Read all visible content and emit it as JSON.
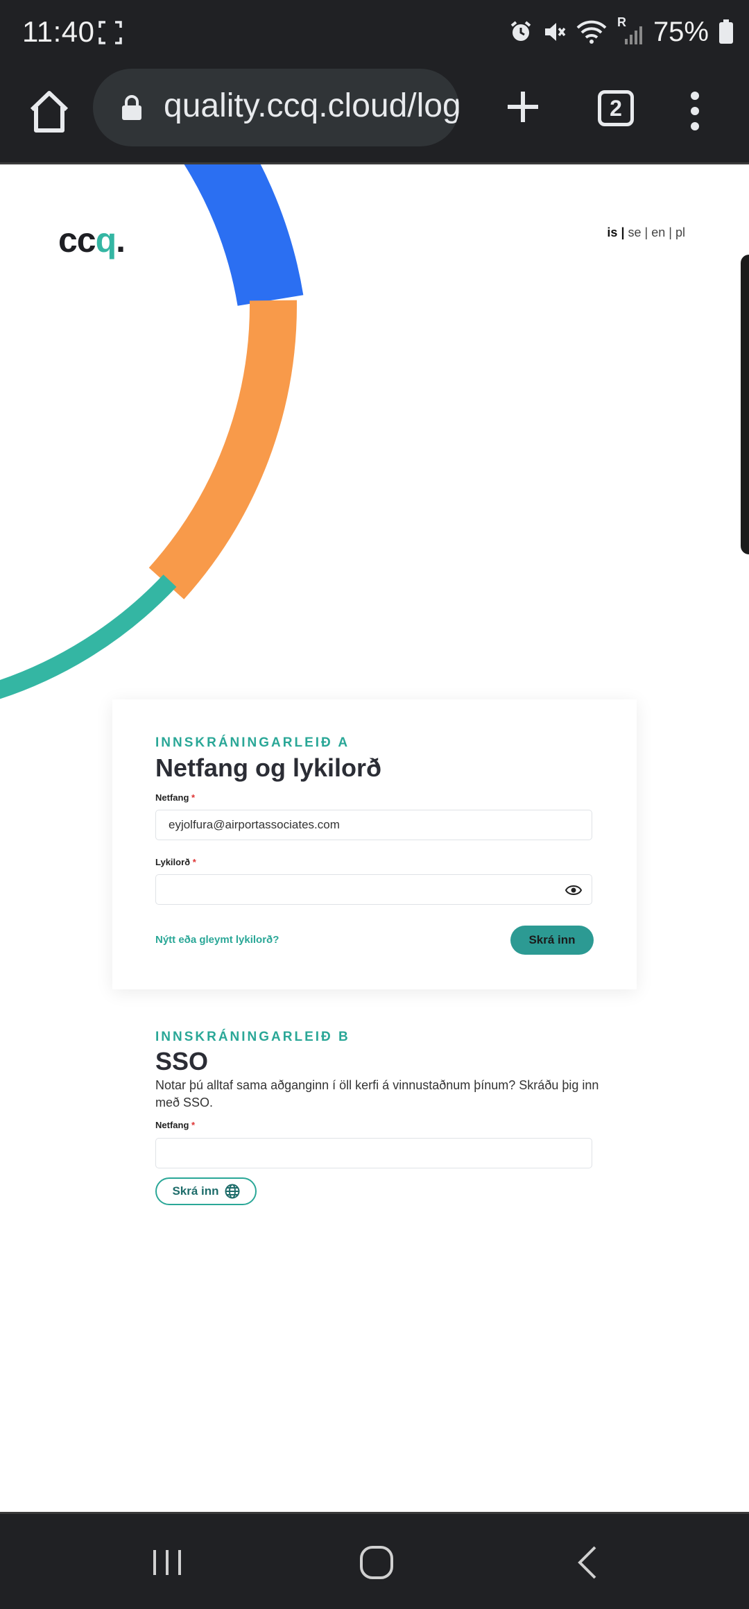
{
  "status_bar": {
    "time": "11:40",
    "battery": "75%",
    "signal_label": "R",
    "icons": [
      "screenshot-bracket-icon",
      "alarm-icon",
      "mute-icon",
      "wifi-icon",
      "signal-icon",
      "battery-icon"
    ]
  },
  "browser": {
    "url": "quality.ccq.cloud/log",
    "tab_count": "2",
    "icons": [
      "home-icon",
      "lock-icon",
      "plus-icon",
      "tabs-icon",
      "more-vert-icon"
    ]
  },
  "page": {
    "logo": {
      "text_a": "cc",
      "text_b": "q",
      "dot": "."
    },
    "languages": {
      "active": "is",
      "items": [
        "se",
        "en",
        "pl"
      ],
      "separator": "|"
    },
    "method_a": {
      "eyebrow": "INNSKRÁNINGARLEIÐ A",
      "title": "Netfang og lykilorð",
      "email_label": "Netfang",
      "email_value": "eyjolfura@airportassociates.com",
      "password_label": "Lykilorð",
      "password_value": "",
      "required_mark": "*",
      "forgot_link": "Nýtt eða gleymt lykilorð?",
      "submit": "Skrá inn"
    },
    "method_b": {
      "eyebrow": "INNSKRÁNINGARLEIÐ B",
      "title": "SSO",
      "description": "Notar þú alltaf sama aðganginn í öll kerfi á vinnustaðnum þínum? Skráðu þig inn með SSO.",
      "email_label": "Netfang",
      "email_value": "",
      "required_mark": "*",
      "submit": "Skrá inn"
    },
    "colors": {
      "blue": "#2b6ff2",
      "orange": "#f89a4a",
      "teal": "#34b6a3",
      "button": "#2c9a93"
    }
  },
  "nav_bar": {
    "icons": [
      "recents-icon",
      "home-circle-icon",
      "back-icon"
    ]
  }
}
